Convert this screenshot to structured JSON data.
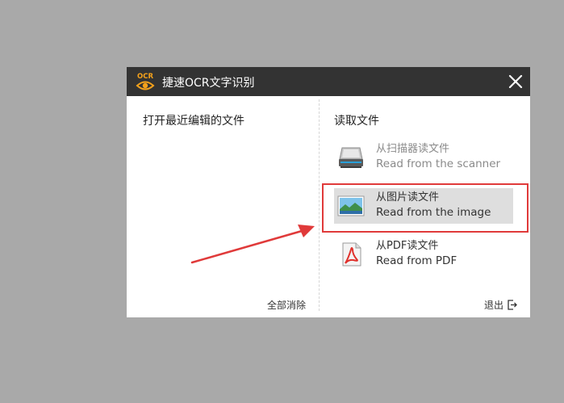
{
  "window": {
    "title": "捷速OCR文字识别",
    "logo_text": "OCR",
    "accent_color": "#f5a21b",
    "titlebar_color": "#333333"
  },
  "left_panel": {
    "title": "打开最近编辑的文件",
    "clear_label": "全部消除"
  },
  "right_panel": {
    "title": "读取文件",
    "exit_label": "退出",
    "options": [
      {
        "zh": "从扫描器读文件",
        "en": "Read from the scanner",
        "icon": "scanner-icon",
        "state": "disabled"
      },
      {
        "zh": "从图片读文件",
        "en": "Read from the image",
        "icon": "image-icon",
        "state": "selected"
      },
      {
        "zh": "从PDF读文件",
        "en": "Read from PDF",
        "icon": "pdf-icon",
        "state": "normal"
      }
    ]
  },
  "annotation": {
    "highlight_color": "#e03a3a"
  }
}
